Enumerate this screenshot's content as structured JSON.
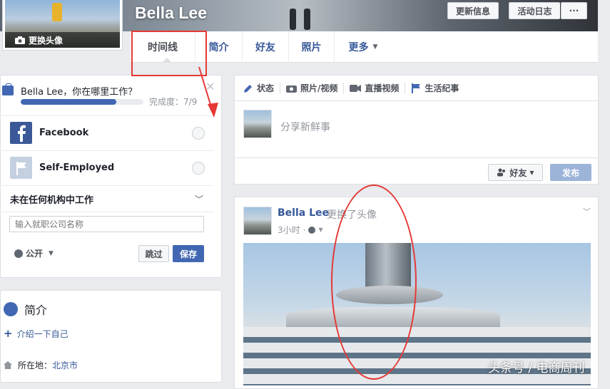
{
  "profile": {
    "name": "Bella Lee",
    "change_photo": "更换头像"
  },
  "header_buttons": {
    "update_info": "更新信息",
    "activity_log": "活动日志",
    "more": "···"
  },
  "tabs": [
    {
      "label": "时间线"
    },
    {
      "label": "简介"
    },
    {
      "label": "好友"
    },
    {
      "label": "照片"
    },
    {
      "label": "更多"
    }
  ],
  "work_prompt": {
    "question": "Bella Lee，你在哪里工作？",
    "progress_fraction": 0.777,
    "completion": "完成度：7/9",
    "options": [
      {
        "name": "Facebook",
        "icon": "facebook-logo-icon"
      },
      {
        "name": "Self-Employed",
        "icon": "flag-icon"
      }
    ],
    "no_org": "未在任何机构中工作",
    "company_placeholder": "输入就职公司名称",
    "privacy": "公开",
    "skip": "跳过",
    "save": "保存"
  },
  "intro": {
    "title": "简介",
    "add": "介绍一下自己",
    "location_label": "所在地：",
    "location_value": "北京市"
  },
  "composer": {
    "tabs": [
      {
        "label": "状态",
        "icon": "pencil-icon"
      },
      {
        "label": "照片/视频",
        "icon": "camera-icon"
      },
      {
        "label": "直播视频",
        "icon": "video-icon"
      },
      {
        "label": "生活纪事",
        "icon": "flag-icon"
      }
    ],
    "placeholder": "分享新鲜事",
    "audience": "好友",
    "post": "发布"
  },
  "post": {
    "author": "Bella Lee",
    "action": "更换了头像",
    "time": "3小时"
  },
  "watermark": "头条号 / 电商周刊",
  "colors": {
    "accent": "#4267b2",
    "link": "#365899",
    "annotation": "#e53935"
  }
}
